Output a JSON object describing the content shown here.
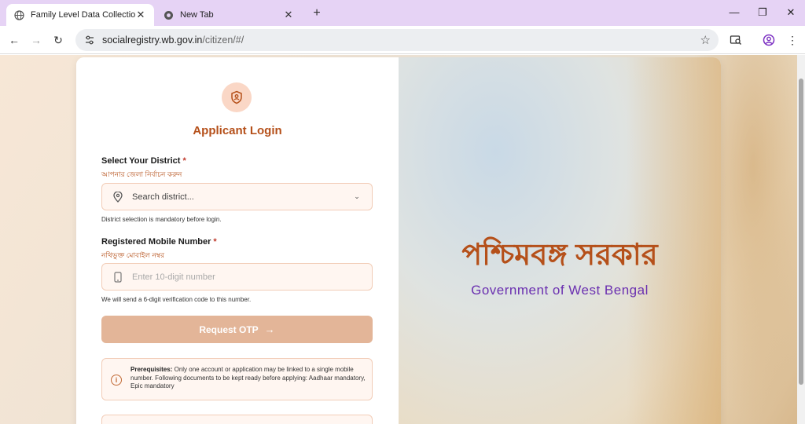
{
  "browser": {
    "tabs": [
      {
        "title": "Family Level Data Collection Fo",
        "active": true
      },
      {
        "title": "New Tab",
        "active": false
      }
    ],
    "url_host": "socialregistry.wb.gov.in",
    "url_path": "/citizen/#/"
  },
  "login": {
    "title": "Applicant Login",
    "district_label": "Select Your District",
    "required_mark": "*",
    "district_sublabel": "আপনার জেলা নির্বাচন করুন",
    "district_placeholder": "Search district...",
    "district_hint": "District selection is mandatory before login.",
    "mobile_label": "Registered Mobile Number",
    "mobile_sublabel": "নথিভুক্ত মোবাইল নম্বর",
    "mobile_placeholder": "Enter 10-digit number",
    "mobile_hint": "We will send a 6-digit verification code to this number.",
    "otp_button": "Request OTP",
    "prereq_title": "Prerequisites:",
    "prereq_text": "Only one account or application may be linked to a single mobile number. Following documents to be kept ready before applying: Aadhaar mandatory, Epic mandatory"
  },
  "brand": {
    "bengali_title": "পশ্চিমবঙ্গ সরকার",
    "english_title": "Government of West Bengal"
  },
  "colors": {
    "accent": "#b5501a",
    "button": "#e3b598",
    "purple": "#6a2fb0"
  }
}
